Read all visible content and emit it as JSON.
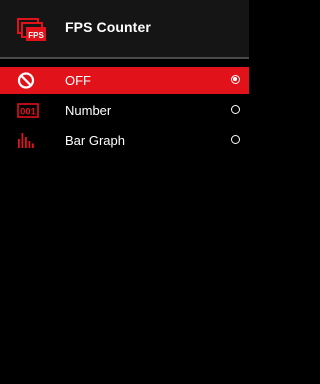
{
  "header": {
    "title": "FPS Counter",
    "icon": "fps-counter-icon",
    "icon_text": "FPS"
  },
  "menu": {
    "items": [
      {
        "label": "OFF",
        "icon": "off-circle-slash-icon",
        "selected": true
      },
      {
        "label": "Number",
        "icon": "number-icon",
        "icon_text": "001",
        "selected": false
      },
      {
        "label": "Bar Graph",
        "icon": "bar-graph-icon",
        "selected": false
      }
    ]
  },
  "colors": {
    "background": "#000000",
    "header_background": "#151515",
    "accent": "#e1121a",
    "text": "#ffffff"
  }
}
